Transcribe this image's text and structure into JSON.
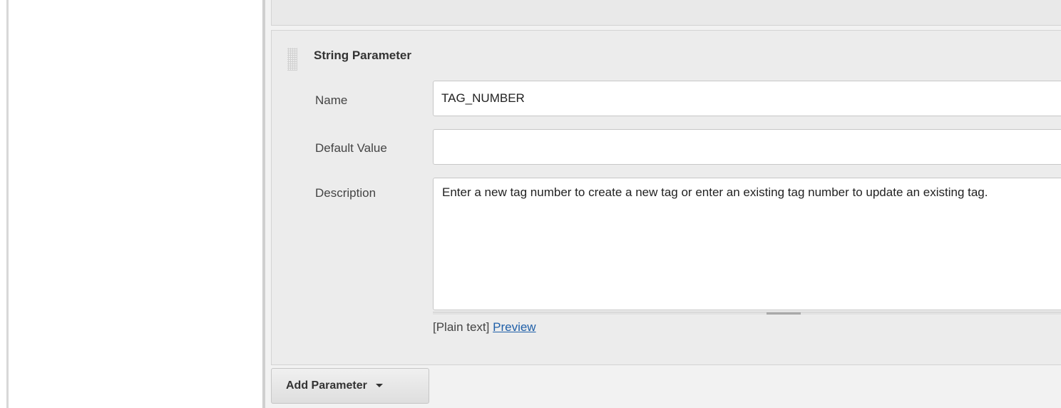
{
  "param": {
    "type_label": "String Parameter",
    "fields": {
      "name": {
        "label": "Name",
        "value": "TAG_NUMBER"
      },
      "default_value": {
        "label": "Default Value",
        "value": ""
      },
      "description": {
        "label": "Description",
        "value": "Enter a new tag number to create a new tag or enter an existing tag number to update an existing tag."
      }
    },
    "preview": {
      "plain_text_label": "[Plain text]",
      "preview_link": "Preview"
    }
  },
  "actions": {
    "add_parameter_label": "Add Parameter"
  },
  "icons": {
    "drag_handle": "drag-handle-icon",
    "dropdown": "chevron-down-icon"
  },
  "colors": {
    "panel_bg": "#ececec",
    "link": "#1f5fa8",
    "border": "#c7c7c7"
  }
}
